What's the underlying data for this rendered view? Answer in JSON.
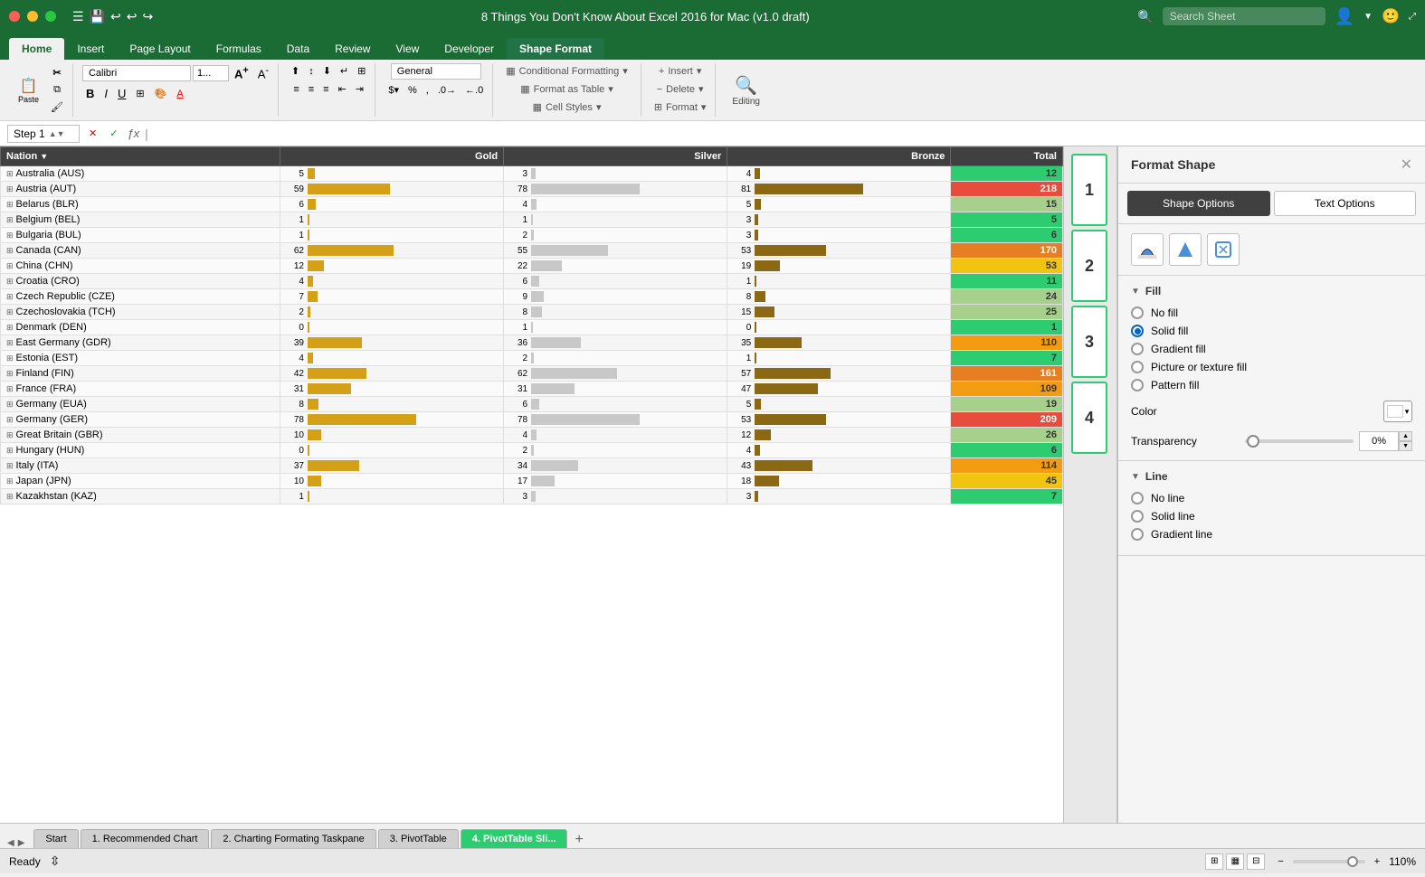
{
  "titleBar": {
    "title": "8 Things You Don't Know About Excel 2016 for Mac (v1.0 draft)",
    "searchPlaceholder": "Search Sheet"
  },
  "tabs": [
    {
      "label": "Home",
      "active": true
    },
    {
      "label": "Insert",
      "active": false
    },
    {
      "label": "Page Layout",
      "active": false
    },
    {
      "label": "Formulas",
      "active": false
    },
    {
      "label": "Data",
      "active": false
    },
    {
      "label": "Review",
      "active": false
    },
    {
      "label": "View",
      "active": false
    },
    {
      "label": "Developer",
      "active": false
    },
    {
      "label": "Shape Format",
      "active": false,
      "special": true
    }
  ],
  "ribbon": {
    "pastLabel": "Paste",
    "fontName": "Calibri",
    "fontSize": "1...",
    "increaseFontLabel": "A+",
    "decreaseFontLabel": "A-",
    "boldLabel": "B",
    "italicLabel": "I",
    "underlineLabel": "U",
    "numberFormat": "General",
    "conditionalFormatting": "Conditional Formatting",
    "formatAsTable": "Format as Table",
    "cellStyles": "Cell Styles",
    "insertLabel": "Insert",
    "deleteLabel": "Delete",
    "formatLabel": "Format",
    "editingLabel": "Editing"
  },
  "formulaBar": {
    "cellRef": "Step 1",
    "formula": ""
  },
  "tableHeaders": [
    "Nation",
    "Gold",
    "Silver",
    "Bronze",
    "Total"
  ],
  "tableData": [
    {
      "nation": "Australia (AUS)",
      "gold": 5,
      "silver": 3,
      "bronze": 4,
      "total": 12,
      "colorClass": "total-low"
    },
    {
      "nation": "Austria (AUT)",
      "gold": 59,
      "silver": 78,
      "bronze": 81,
      "total": 218,
      "colorClass": "total-high"
    },
    {
      "nation": "Belarus (BLR)",
      "gold": 6,
      "silver": 4,
      "bronze": 5,
      "total": 15,
      "colorClass": "total-low"
    },
    {
      "nation": "Belgium (BEL)",
      "gold": 1,
      "silver": 1,
      "bronze": 3,
      "total": 5,
      "colorClass": "total-very-low"
    },
    {
      "nation": "Bulgaria (BUL)",
      "gold": 1,
      "silver": 2,
      "bronze": 3,
      "total": 6,
      "colorClass": "total-very-low"
    },
    {
      "nation": "Canada (CAN)",
      "gold": 62,
      "silver": 55,
      "bronze": 53,
      "total": 170,
      "colorClass": "total-high"
    },
    {
      "nation": "China (CHN)",
      "gold": 12,
      "silver": 22,
      "bronze": 19,
      "total": 53,
      "colorClass": "total-low-med"
    },
    {
      "nation": "Croatia (CRO)",
      "gold": 4,
      "silver": 6,
      "bronze": 1,
      "total": 11,
      "colorClass": "total-very-low"
    },
    {
      "nation": "Czech Republic (CZE)",
      "gold": 7,
      "silver": 9,
      "bronze": 8,
      "total": 24,
      "colorClass": "total-low"
    },
    {
      "nation": "Czechoslovakia (TCH)",
      "gold": 2,
      "silver": 8,
      "bronze": 15,
      "total": 25,
      "colorClass": "total-low"
    },
    {
      "nation": "Denmark (DEN)",
      "gold": 0,
      "silver": 1,
      "bronze": 0,
      "total": 1,
      "colorClass": "total-very-low"
    },
    {
      "nation": "East Germany (GDR)",
      "gold": 39,
      "silver": 36,
      "bronze": 35,
      "total": 110,
      "colorClass": "total-med-high"
    },
    {
      "nation": "Estonia (EST)",
      "gold": 4,
      "silver": 2,
      "bronze": 1,
      "total": 7,
      "colorClass": "total-very-low"
    },
    {
      "nation": "Finland (FIN)",
      "gold": 42,
      "silver": 62,
      "bronze": 57,
      "total": 161,
      "colorClass": "total-high"
    },
    {
      "nation": "France (FRA)",
      "gold": 31,
      "silver": 31,
      "bronze": 47,
      "total": 109,
      "colorClass": "total-med-high"
    },
    {
      "nation": "Germany (EUA)",
      "gold": 8,
      "silver": 6,
      "bronze": 5,
      "total": 19,
      "colorClass": "total-low"
    },
    {
      "nation": "Germany (GER)",
      "gold": 78,
      "silver": 78,
      "bronze": 53,
      "total": 209,
      "colorClass": "total-high"
    },
    {
      "nation": "Great Britain (GBR)",
      "gold": 10,
      "silver": 4,
      "bronze": 12,
      "total": 26,
      "colorClass": "total-low"
    },
    {
      "nation": "Hungary (HUN)",
      "gold": 0,
      "silver": 2,
      "bronze": 4,
      "total": 6,
      "colorClass": "total-very-low"
    },
    {
      "nation": "Italy (ITA)",
      "gold": 37,
      "silver": 34,
      "bronze": 43,
      "total": 114,
      "colorClass": "total-med-high"
    },
    {
      "nation": "Japan (JPN)",
      "gold": 10,
      "silver": 17,
      "bronze": 18,
      "total": 45,
      "colorClass": "total-low-med"
    },
    {
      "nation": "Kazakhstan (KAZ)",
      "gold": 1,
      "silver": 3,
      "bronze": 3,
      "total": 7,
      "colorClass": "total-very-low"
    }
  ],
  "formatShapePanel": {
    "title": "Format Shape",
    "shapeOptionsTab": "Shape Options",
    "textOptionsTab": "Text Options",
    "fillSection": "Fill",
    "fillOptions": [
      {
        "label": "No fill",
        "checked": false
      },
      {
        "label": "Solid fill",
        "checked": true
      },
      {
        "label": "Gradient fill",
        "checked": false
      },
      {
        "label": "Picture or texture fill",
        "checked": false
      },
      {
        "label": "Pattern fill",
        "checked": false
      }
    ],
    "colorLabel": "Color",
    "transparencyLabel": "Transparency",
    "transparencyValue": "0%",
    "lineSection": "Line",
    "lineOptions": [
      {
        "label": "No line",
        "checked": false
      },
      {
        "label": "Solid line",
        "checked": false
      },
      {
        "label": "Gradient line",
        "checked": false
      }
    ]
  },
  "numberedItems": [
    "1",
    "2",
    "3",
    "4"
  ],
  "sheetTabs": [
    {
      "label": "Start"
    },
    {
      "label": "1. Recommended Chart"
    },
    {
      "label": "2. Charting Formating Taskpane"
    },
    {
      "label": "3. PivotTable"
    },
    {
      "label": "4. PivotTable Sli...",
      "active": true
    }
  ],
  "statusBar": {
    "ready": "Ready",
    "zoom": "110%"
  }
}
